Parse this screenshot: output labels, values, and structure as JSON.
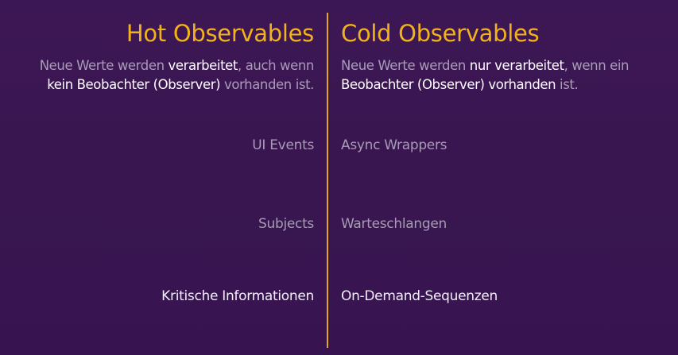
{
  "hot": {
    "title": "Hot Observables",
    "desc_line1_a": "Neue Werte werden ",
    "desc_line1_b": "verarbeitet",
    "desc_line1_c": ", auch wenn",
    "desc_line2_a": "kein Beobachter (Observer)",
    "desc_line2_b": " vorhanden ist.",
    "items": [
      "UI Events",
      "Subjects",
      "Kritische Informationen"
    ]
  },
  "cold": {
    "title": "Cold Observables",
    "desc_line1_a": "Neue Werte werden ",
    "desc_line1_b": "nur verarbeitet",
    "desc_line1_c": ", wenn ein",
    "desc_line2_a": "Beobachter (Observer) vorhanden",
    "desc_line2_b": " ist.",
    "items": [
      "Async Wrappers",
      "Warteschlangen",
      "On-Demand-Sequenzen"
    ]
  },
  "colors": {
    "background": "#3b1753",
    "accent": "#f2b31a",
    "divider": "#e6a812",
    "muted_text": "#a99cb8",
    "highlight_text": "#ffffff"
  }
}
